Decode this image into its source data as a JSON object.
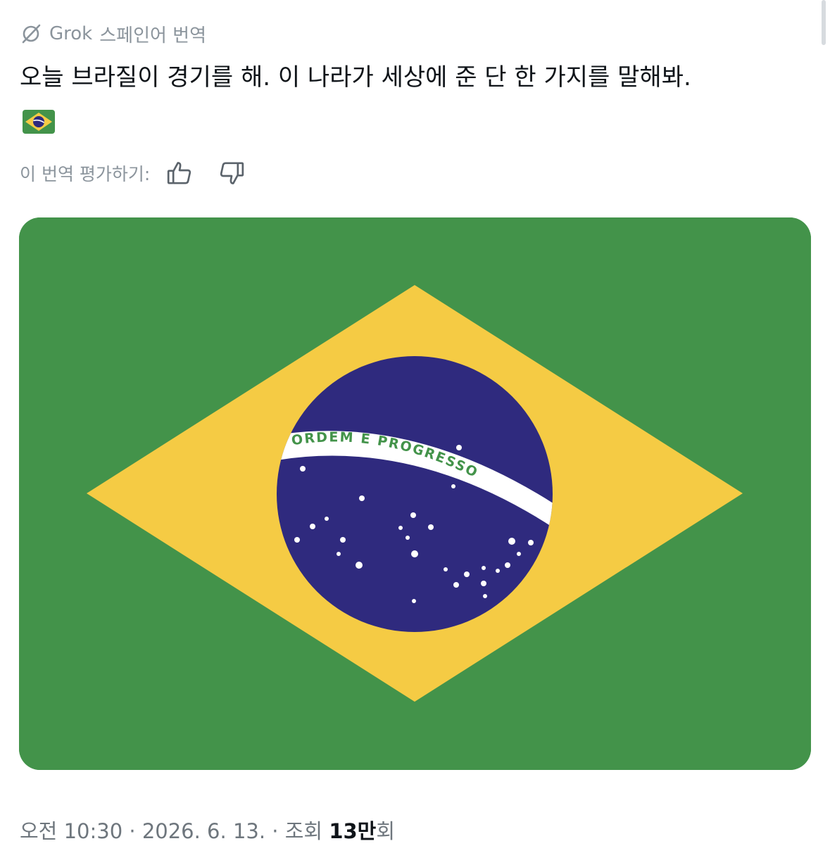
{
  "translation": {
    "provider": "Grok",
    "label": "스페인어 번역",
    "text": "오늘 브라질이 경기를 해. 이 나라가 세상에 준 단 한 가지를 말해봐.",
    "emoji": "🇧🇷"
  },
  "rating": {
    "label": "이 번역 평가하기:",
    "thumbs_up_icon": "thumbs-up-icon",
    "thumbs_down_icon": "thumbs-down-icon"
  },
  "media": {
    "flag_motto": "ORDEM E PROGRESSO",
    "colors": {
      "green": "#43934a",
      "yellow": "#f5cb44",
      "blue": "#2f2a7e",
      "white": "#ffffff"
    }
  },
  "meta": {
    "time": "오전 10:30",
    "separator": "·",
    "date": "2026. 6. 13.",
    "views_label": "조회",
    "views_number": "13",
    "views_unit": "만",
    "views_suffix": "회"
  }
}
